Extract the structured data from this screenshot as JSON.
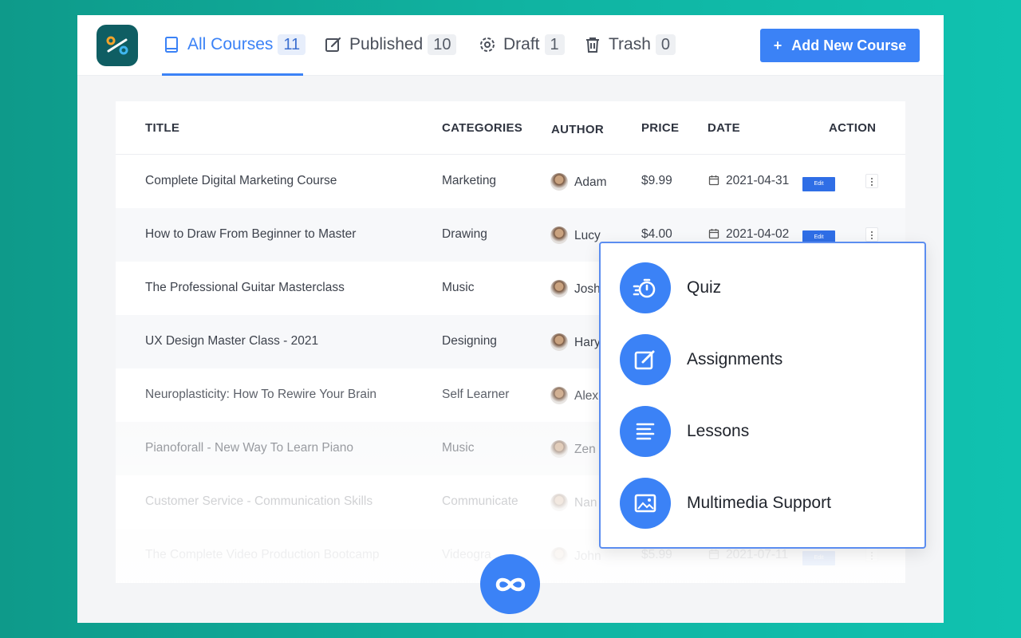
{
  "tabs": [
    {
      "label": "All Courses",
      "count": "11",
      "icon": "book-icon"
    },
    {
      "label": "Published",
      "count": "10",
      "icon": "edit-icon"
    },
    {
      "label": "Draft",
      "count": "1",
      "icon": "gear-icon"
    },
    {
      "label": "Trash",
      "count": "0",
      "icon": "trash-icon"
    }
  ],
  "add_button": {
    "label": "Add New Course",
    "plus": "+"
  },
  "table": {
    "headers": {
      "title": "TITLE",
      "categories": "CATEGORIES",
      "author": "AUTHOR",
      "price": "PRICE",
      "date": "DATE",
      "action": "ACTION"
    },
    "rows": [
      {
        "title": "Complete Digital Marketing Course",
        "category": "Marketing",
        "author": "Adam",
        "price": "$9.99",
        "date": "2021-04-31",
        "edit": "Edit"
      },
      {
        "title": "How to Draw From Beginner to Master",
        "category": "Drawing",
        "author": "Lucy",
        "price": "$4.00",
        "date": "2021-04-02",
        "edit": "Edit"
      },
      {
        "title": "The Professional Guitar Masterclass",
        "category": "Music",
        "author": "Josh",
        "price": "",
        "date": "",
        "edit": ""
      },
      {
        "title": "UX Design Master Class - 2021",
        "category": "Designing",
        "author": "Hary",
        "price": "",
        "date": "",
        "edit": ""
      },
      {
        "title": "Neuroplasticity: How To Rewire Your Brain",
        "category": "Self Learner",
        "author": "Alex",
        "price": "",
        "date": "",
        "edit": ""
      },
      {
        "title": "Pianoforall - New Way To Learn Piano",
        "category": "Music",
        "author": "Zen",
        "price": "",
        "date": "",
        "edit": ""
      },
      {
        "title": "Customer Service - Communication Skills",
        "category": "Communicate",
        "author": "Nan",
        "price": "",
        "date": "",
        "edit": ""
      },
      {
        "title": "The Complete Video Production Bootcamp",
        "category": "Videogra",
        "author": "John",
        "price": "$5.99",
        "date": "2021-07-11",
        "edit": "Edit"
      }
    ]
  },
  "dropdown": {
    "items": [
      {
        "label": "Quiz",
        "icon": "stopwatch-icon"
      },
      {
        "label": "Assignments",
        "icon": "edit-icon"
      },
      {
        "label": "Lessons",
        "icon": "lines-icon"
      },
      {
        "label": "Multimedia Support",
        "icon": "image-icon"
      }
    ]
  },
  "colors": {
    "accent": "#3b82f6",
    "background": "#0e9a8a",
    "logo": "#0f5e63"
  }
}
